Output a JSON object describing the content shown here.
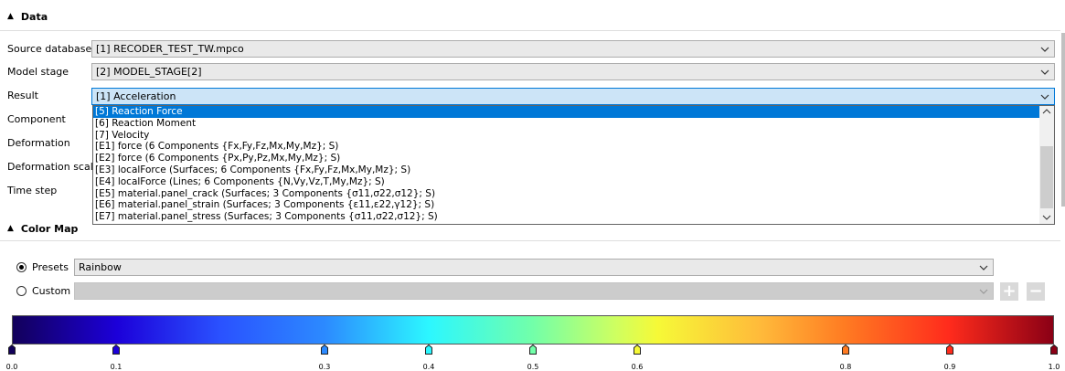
{
  "data_section": {
    "title": "Data"
  },
  "labels": {
    "source_database": "Source database",
    "model_stage": "Model stage",
    "result": "Result",
    "component": "Component",
    "deformation": "Deformation",
    "deformation_scale": "Deformation scale",
    "time_step": "Time step"
  },
  "combos": {
    "source_database": "[1] RECODER_TEST_TW.mpco",
    "model_stage": "[2] MODEL_STAGE[2]",
    "result": "[1] Acceleration"
  },
  "dropdown_items": [
    "[5] Reaction Force",
    "[6] Reaction Moment",
    "[7] Velocity",
    "[E1] force (6 Components {Fx,Fy,Fz,Mx,My,Mz}; S)",
    "[E2] force (6 Components {Px,Py,Pz,Mx,My,Mz}; S)",
    "[E3] localForce (Surfaces; 6 Components {Fx,Fy,Fz,Mx,My,Mz}; S)",
    "[E4] localForce (Lines; 6 Components {N,Vy,Vz,T,My,Mz}; S)",
    "[E5] material.panel_crack (Surfaces; 3 Components {σ11,σ22,σ12}; S)",
    "[E6] material.panel_strain (Surfaces; 3 Components {ε11,ε22,γ12}; S)",
    "[E7] material.panel_stress (Surfaces; 3 Components {σ11,σ22,σ12}; S)"
  ],
  "dropdown_selected_index": 0,
  "colormap_section": {
    "title": "Color Map"
  },
  "presets": {
    "label": "Presets",
    "value": "Rainbow",
    "selected": true
  },
  "custom": {
    "label": "Custom",
    "value": "",
    "selected": false
  },
  "buttons": {
    "add": "+",
    "remove": "−"
  },
  "colorbar": {
    "stops": [
      {
        "pos": 0.0,
        "label": "0.0",
        "color": "#12005a"
      },
      {
        "pos": 0.1,
        "label": "0.1",
        "color": "#1c00d9"
      },
      {
        "pos": 0.3,
        "label": "0.3",
        "color": "#2c8aff"
      },
      {
        "pos": 0.4,
        "label": "0.4",
        "color": "#2cf7ff"
      },
      {
        "pos": 0.5,
        "label": "0.5",
        "color": "#72ffa9"
      },
      {
        "pos": 0.6,
        "label": "0.6",
        "color": "#f6f937"
      },
      {
        "pos": 0.8,
        "label": "0.8",
        "color": "#ff7b22"
      },
      {
        "pos": 0.9,
        "label": "0.9",
        "color": "#ff2b1c"
      },
      {
        "pos": 1.0,
        "label": "1.0",
        "color": "#8a0015"
      }
    ]
  },
  "colors": {
    "accent": "#0078d7"
  }
}
